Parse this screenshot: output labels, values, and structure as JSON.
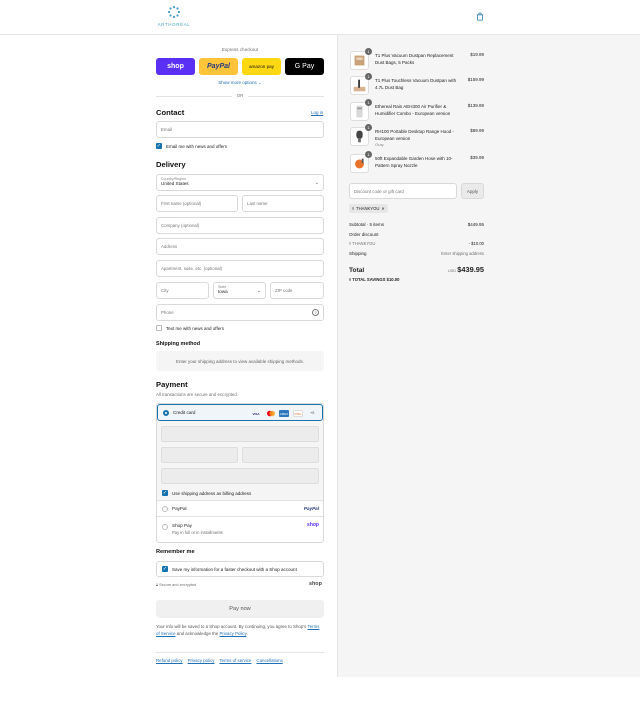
{
  "header": {
    "brand": "ARTHOREAL",
    "cart_icon": "shopping-bag-icon"
  },
  "express": {
    "title": "Express checkout",
    "shop_label": "shop",
    "paypal_label": "PayPal",
    "amazon_label": "amazon pay",
    "gpay_label": "G Pay",
    "show_more": "Show more options ⌄",
    "or": "OR"
  },
  "contact": {
    "title": "Contact",
    "login_link": "Log in",
    "email_placeholder": "Email",
    "email_news": "Email me with news and offers"
  },
  "delivery": {
    "title": "Delivery",
    "country_label": "Country/Region",
    "country_value": "United States",
    "first_name": "First name (optional)",
    "last_name": "Last name",
    "company": "Company (optional)",
    "address": "Address",
    "apartment": "Apartment, suite, etc. (optional)",
    "city": "City",
    "state_label": "State",
    "state_value": "Iowa",
    "zip": "ZIP code",
    "phone": "Phone",
    "text_news": "Text me with news and offers"
  },
  "shipping": {
    "title": "Shipping method",
    "placeholder": "Enter your shipping address to view available shipping methods."
  },
  "payment": {
    "title": "Payment",
    "subtitle": "All transactions are secure and encrypted.",
    "credit_card": "Credit card",
    "card_logos": [
      "VISA",
      "MC",
      "AMEX",
      "DISC",
      "+5"
    ],
    "billing_same": "Use shipping address as billing address",
    "paypal": "PayPal",
    "paypal_logo": "PayPal",
    "shop_pay": "Shop Pay",
    "shop_pay_sub": "Pay in full or in installments",
    "shop_logo": "shop"
  },
  "remember": {
    "title": "Remember me",
    "save_info": "Save my information for a faster checkout with a Shop account",
    "secure": "Secure and encrypted",
    "shop_logo": "shop"
  },
  "pay_now": "Pay now",
  "legal": {
    "text_before": "Your info will be saved to a Shop account. By continuing, you agree to Shop’s ",
    "terms": "Terms of Service",
    "text_middle": " and acknowledge the ",
    "privacy": "Privacy Policy",
    "text_end": "."
  },
  "footer_links": [
    "Refund policy",
    "Privacy policy",
    "Terms of service",
    "Cancellations"
  ],
  "order": {
    "items": [
      {
        "qty": "1",
        "name": "T1 Plus Vacuum Dustpan Replacement Dust Bags, 5 Packs",
        "sub": "",
        "price": "$19.99"
      },
      {
        "qty": "1",
        "name": "T1 Plus Touchless Vacuum Dustpan with 4.7L Dust Bag",
        "sub": "",
        "price": "$159.99"
      },
      {
        "qty": "1",
        "name": "Ethereal Rain AEH300 Air Purifier & Humidifier Combo - European version",
        "sub": "",
        "price": "$139.99"
      },
      {
        "qty": "1",
        "name": "RH100 Portable Desktop Range Hood - European version",
        "sub": "Gray",
        "price": "$89.99"
      },
      {
        "qty": "1",
        "name": "50ft Expandable Garden Hose with 10-Pattern Spray Nozzle",
        "sub": "",
        "price": "$39.99"
      }
    ],
    "discount_placeholder": "Discount code or gift card",
    "apply": "Apply",
    "applied_code": "THANKYOU",
    "subtotal_label": "Subtotal · 5 items",
    "subtotal_value": "$449.95",
    "order_discount_label": "Order discount",
    "discount_code": "THANKYOU",
    "discount_value": "- $10.00",
    "shipping_label": "Shipping",
    "shipping_value": "Enter shipping address",
    "total_label": "Total",
    "currency": "USD",
    "total_value": "$439.95",
    "savings_label": "TOTAL SAVINGS",
    "savings_value": "$10.00"
  },
  "colors": {
    "accent": "#1773b0",
    "shop": "#5a31f4",
    "paypal": "#ffc439",
    "amazon": "#ffd814",
    "brand": "#4a9fc6"
  }
}
